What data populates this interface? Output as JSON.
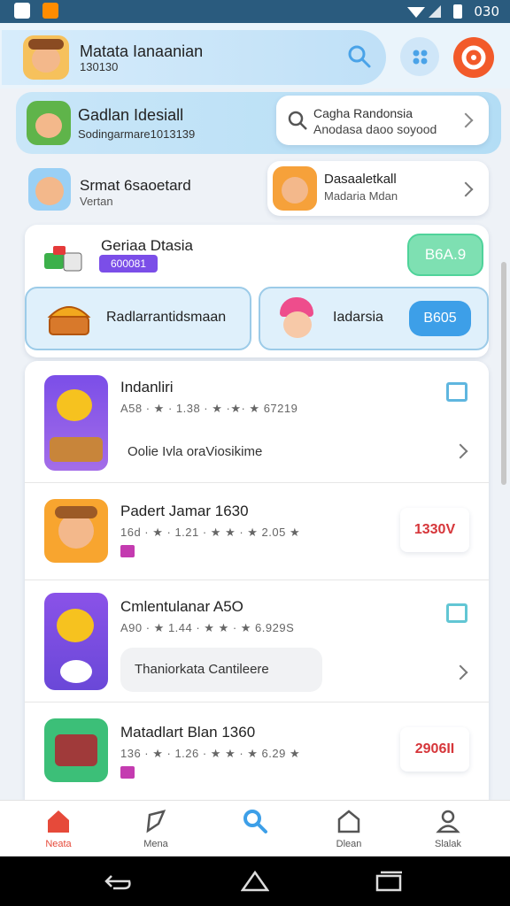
{
  "status": {
    "time": "030"
  },
  "header": {
    "title": "Matata Ianaanian",
    "subtitle": "130130"
  },
  "search_card": {
    "title": "Gadlan Idesiall",
    "subtitle": "Sodingarmare1013139",
    "field_line1": "Cagha Randonsia",
    "field_line2": "Anodasa daoo soyood"
  },
  "row_a": {
    "left_title": "Srmat 6saoetard",
    "left_sub": "Vertan",
    "right_title": "Dasaaletkall",
    "right_sub": "Madaria Mdan"
  },
  "promo": {
    "title": "Geriaa Dtasia",
    "badge": "600081",
    "button": "B6A.9"
  },
  "tiles": {
    "left_label": "Radlarrantidsmaan",
    "right_label": "Iadarsia",
    "right_button": "B605"
  },
  "list": [
    {
      "title": "Indanliri",
      "rating_a": "A58 · ★ · 1.38 · ★ ·★· ★ 67219",
      "desc": "Oolie Ivla oraViosikime"
    },
    {
      "title": "Padert Jamar 1630",
      "rating_a": "16d · ★ · 1.21 · ★ ★ · ★ 2.05 ★",
      "price": "1330V"
    },
    {
      "title": "Cmlentulanar A5O",
      "rating_a": "A90 · ★ 1.44 · ★ ★ · ★ 6.929S",
      "desc": "Thaniorkata Cantileere"
    },
    {
      "title": "Matadlart Blan 1360",
      "rating_a": "136 · ★ · 1.26 · ★ ★ · ★ 6.29 ★",
      "price": "2906II"
    }
  ],
  "nav": {
    "items": [
      "Neata",
      "Mena",
      "",
      "Dlean",
      "Slalak"
    ]
  },
  "colors": {
    "accent": "#4aa3e8",
    "red": "#d6363a",
    "green": "#4fd39a",
    "purple": "#7b4ee8"
  }
}
